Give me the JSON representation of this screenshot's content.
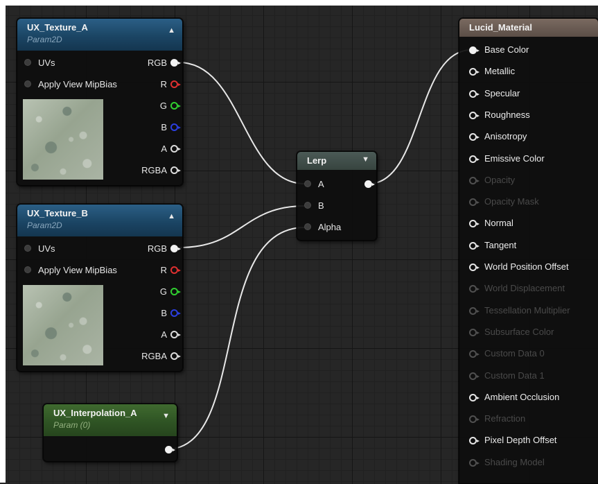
{
  "texture_a": {
    "title": "UX_Texture_A",
    "subtitle": "Param2D",
    "inputs": [
      "UVs",
      "Apply View MipBias"
    ],
    "outputs": [
      "RGB",
      "R",
      "G",
      "B",
      "A",
      "RGBA"
    ]
  },
  "texture_b": {
    "title": "UX_Texture_B",
    "subtitle": "Param2D",
    "inputs": [
      "UVs",
      "Apply View MipBias"
    ],
    "outputs": [
      "RGB",
      "R",
      "G",
      "B",
      "A",
      "RGBA"
    ]
  },
  "interpolation": {
    "title": "UX_Interpolation_A",
    "subtitle": "Param (0)"
  },
  "lerp": {
    "title": "Lerp",
    "inputs": [
      "A",
      "B",
      "Alpha"
    ]
  },
  "material": {
    "title": "Lucid_Material",
    "pins": [
      {
        "label": "Base Color",
        "state": "connected"
      },
      {
        "label": "Metallic",
        "state": "enabled"
      },
      {
        "label": "Specular",
        "state": "enabled"
      },
      {
        "label": "Roughness",
        "state": "enabled"
      },
      {
        "label": "Anisotropy",
        "state": "enabled"
      },
      {
        "label": "Emissive Color",
        "state": "enabled"
      },
      {
        "label": "Opacity",
        "state": "disabled"
      },
      {
        "label": "Opacity Mask",
        "state": "disabled"
      },
      {
        "label": "Normal",
        "state": "enabled"
      },
      {
        "label": "Tangent",
        "state": "enabled"
      },
      {
        "label": "World Position Offset",
        "state": "enabled"
      },
      {
        "label": "World Displacement",
        "state": "disabled"
      },
      {
        "label": "Tessellation Multiplier",
        "state": "disabled"
      },
      {
        "label": "Subsurface Color",
        "state": "disabled"
      },
      {
        "label": "Custom Data 0",
        "state": "disabled"
      },
      {
        "label": "Custom Data 1",
        "state": "disabled"
      },
      {
        "label": "Ambient Occlusion",
        "state": "enabled"
      },
      {
        "label": "Refraction",
        "state": "disabled"
      },
      {
        "label": "Pixel Depth Offset",
        "state": "enabled"
      },
      {
        "label": "Shading Model",
        "state": "disabled"
      }
    ]
  },
  "icons": {
    "collapse": "collapse-arrow-icon",
    "dropdown": "dropdown-arrow-icon"
  },
  "colors": {
    "texture_header": "#1b4564",
    "param_header": "#2f5424",
    "lerp_header": "#37443f",
    "material_header": "#5b4e47",
    "pin_r": "#e03030",
    "pin_g": "#30d030",
    "pin_b": "#2b3fe0"
  }
}
